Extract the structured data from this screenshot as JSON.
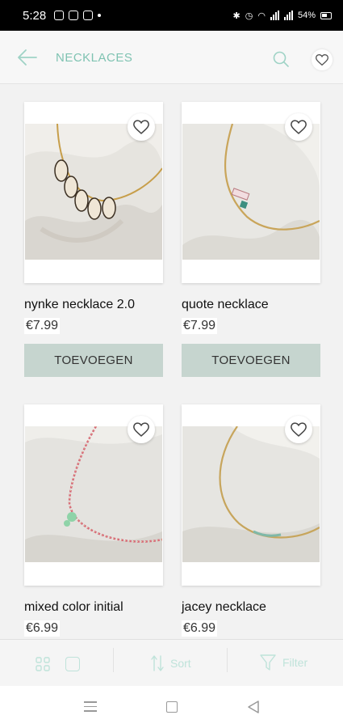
{
  "status_bar": {
    "time": "5:28",
    "battery": "54%"
  },
  "header": {
    "title": "NECKLACES"
  },
  "products": [
    {
      "name": "nynke necklace 2.0",
      "price": "€7.99",
      "button": "TOEVOEGEN"
    },
    {
      "name": "quote necklace",
      "price": "€7.99",
      "button": "TOEVOEGEN"
    },
    {
      "name": "mixed color initial",
      "price": "€6.99"
    },
    {
      "name": "jacey necklace",
      "price": "€6.99"
    }
  ],
  "toolbar": {
    "sort_label": "Sort",
    "filter_label": "Filter"
  },
  "colors": {
    "accent": "#7fc3b2",
    "button_bg": "#c6d5cf",
    "toolbar_icon": "#bfe3da"
  },
  "icons": [
    "back-arrow-icon",
    "search-icon",
    "heart-icon",
    "grid-view-icon",
    "single-view-icon",
    "sort-icon",
    "filter-icon"
  ]
}
